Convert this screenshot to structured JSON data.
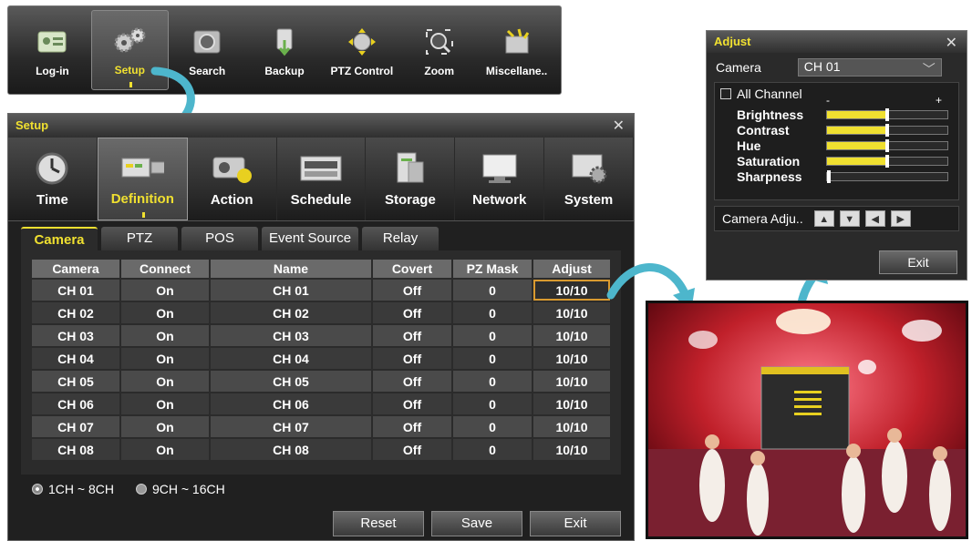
{
  "toolbar": {
    "items": [
      {
        "label": "Log-in",
        "icon": "login-card-icon"
      },
      {
        "label": "Setup",
        "icon": "setup-gears-icon"
      },
      {
        "label": "Search",
        "icon": "search-camera-icon"
      },
      {
        "label": "Backup",
        "icon": "backup-drive-icon"
      },
      {
        "label": "PTZ Control",
        "icon": "ptz-control-icon"
      },
      {
        "label": "Zoom",
        "icon": "zoom-icon"
      },
      {
        "label": "Miscellane..",
        "icon": "miscellaneous-icon"
      }
    ],
    "active_index": 1
  },
  "setup": {
    "title": "Setup",
    "categories": [
      {
        "label": "Time",
        "icon": "clock-icon"
      },
      {
        "label": "Definition",
        "icon": "definition-icon"
      },
      {
        "label": "Action",
        "icon": "action-icon"
      },
      {
        "label": "Schedule",
        "icon": "schedule-icon"
      },
      {
        "label": "Storage",
        "icon": "storage-icon"
      },
      {
        "label": "Network",
        "icon": "network-icon"
      },
      {
        "label": "System",
        "icon": "system-icon"
      }
    ],
    "active_category": 1,
    "tabs": [
      "Camera",
      "PTZ",
      "POS",
      "Event Source",
      "Relay"
    ],
    "active_tab": 0,
    "table": {
      "headers": [
        "Camera",
        "Connect",
        "Name",
        "Covert",
        "PZ Mask",
        "Adjust"
      ],
      "rows": [
        [
          "CH 01",
          "On",
          "CH 01",
          "Off",
          "0",
          "10/10"
        ],
        [
          "CH 02",
          "On",
          "CH 02",
          "Off",
          "0",
          "10/10"
        ],
        [
          "CH 03",
          "On",
          "CH 03",
          "Off",
          "0",
          "10/10"
        ],
        [
          "CH 04",
          "On",
          "CH 04",
          "Off",
          "0",
          "10/10"
        ],
        [
          "CH 05",
          "On",
          "CH 05",
          "Off",
          "0",
          "10/10"
        ],
        [
          "CH 06",
          "On",
          "CH 06",
          "Off",
          "0",
          "10/10"
        ],
        [
          "CH 07",
          "On",
          "CH 07",
          "Off",
          "0",
          "10/10"
        ],
        [
          "CH 08",
          "On",
          "CH 08",
          "Off",
          "0",
          "10/10"
        ]
      ]
    },
    "radios": [
      {
        "label": "1CH ~ 8CH",
        "selected": true
      },
      {
        "label": "9CH ~ 16CH",
        "selected": false
      }
    ],
    "buttons": {
      "reset": "Reset",
      "save": "Save",
      "exit": "Exit"
    }
  },
  "adjust": {
    "title": "Adjust",
    "camera_label": "Camera",
    "camera_value": "CH 01",
    "all_channel_label": "All Channel",
    "minus": "-",
    "plus": "+",
    "sliders": [
      {
        "name": "Brightness",
        "level": 0.5
      },
      {
        "name": "Contrast",
        "level": 0.5
      },
      {
        "name": "Hue",
        "level": 0.5
      },
      {
        "name": "Saturation",
        "level": 0.5
      },
      {
        "name": "Sharpness",
        "level": 0.0
      }
    ],
    "nav_label": "Camera Adju..",
    "exit": "Exit"
  },
  "colors": {
    "accent": "#f0e030",
    "selection": "#d99a30",
    "arrow": "#4db6cc"
  }
}
